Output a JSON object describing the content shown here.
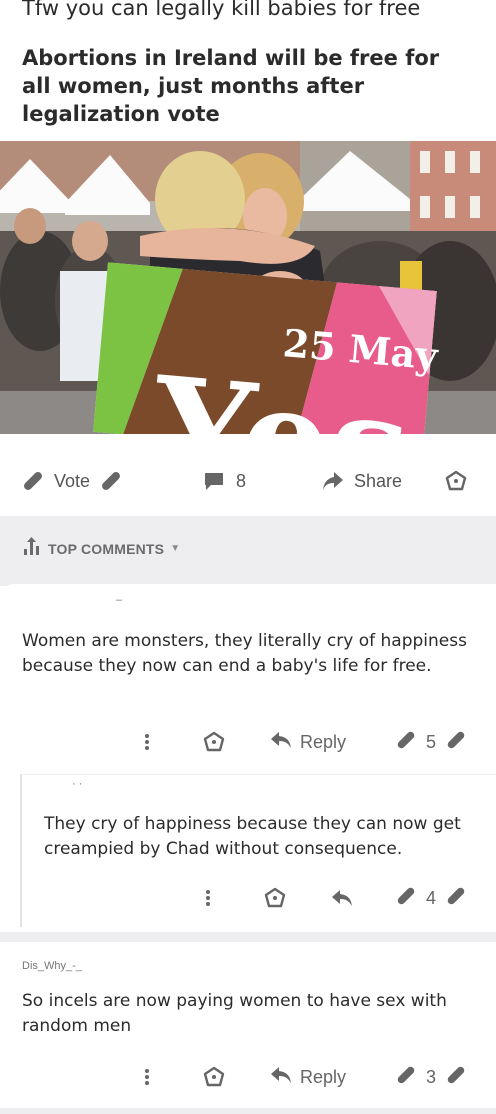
{
  "post": {
    "title": "Tfw you can legally kill babies for free",
    "headline": "Abortions in Ireland will be free for all women, just months after legalization vote",
    "image": {
      "sign_date": "25 May",
      "sign_word": "Yes"
    },
    "actions": {
      "vote_label": "Vote",
      "comment_count": "8",
      "share_label": "Share"
    }
  },
  "comments_header": {
    "label": "TOP COMMENTS"
  },
  "comments": [
    {
      "author": "–",
      "text": "Women are monsters, they literally cry of happiness because they now can end a baby's life for free.",
      "reply_label": "Reply",
      "score": "5",
      "replies": [
        {
          "author": "· ·",
          "text": "They cry of happiness because they can now get creampied by Chad without consequence.",
          "score": "4"
        }
      ]
    },
    {
      "author": "Dis_Why_-_",
      "text": "So incels are now paying women to have sex with random men",
      "reply_label": "Reply",
      "score": "3"
    }
  ],
  "colors": {
    "page_bg": "#ffffff",
    "band_gray": "#eeeef0",
    "text": "#2b2b2b",
    "icon_gray": "#666666"
  }
}
